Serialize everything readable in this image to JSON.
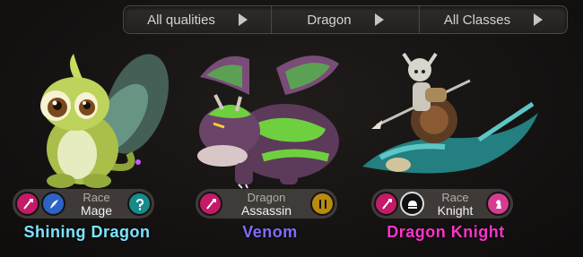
{
  "filters": [
    {
      "label": "All qualities",
      "icon": "triangle-right-icon"
    },
    {
      "label": "Dragon",
      "icon": "triangle-right-icon"
    },
    {
      "label": "All Classes",
      "icon": "triangle-right-icon"
    }
  ],
  "heroes": [
    {
      "name": "Shining Dragon",
      "name_color": "#7ee3ff",
      "race_label": "Race",
      "class_label": "Mage",
      "icons": [
        "pink-sword-icon",
        "blue-feather-icon",
        "teal-help-icon"
      ]
    },
    {
      "name": "Venom",
      "name_color": "#7f6cff",
      "race_label": "Dragon",
      "class_label": "Assassin",
      "icons": [
        "pink-sword-icon",
        "gold-dagger-icon"
      ]
    },
    {
      "name": "Dragon Knight",
      "name_color": "#ff33c8",
      "race_label": "Race",
      "class_label": "Knight",
      "icons": [
        "pink-sword-icon",
        "white-helmet-icon",
        "pink-chess-knight-icon"
      ]
    }
  ]
}
